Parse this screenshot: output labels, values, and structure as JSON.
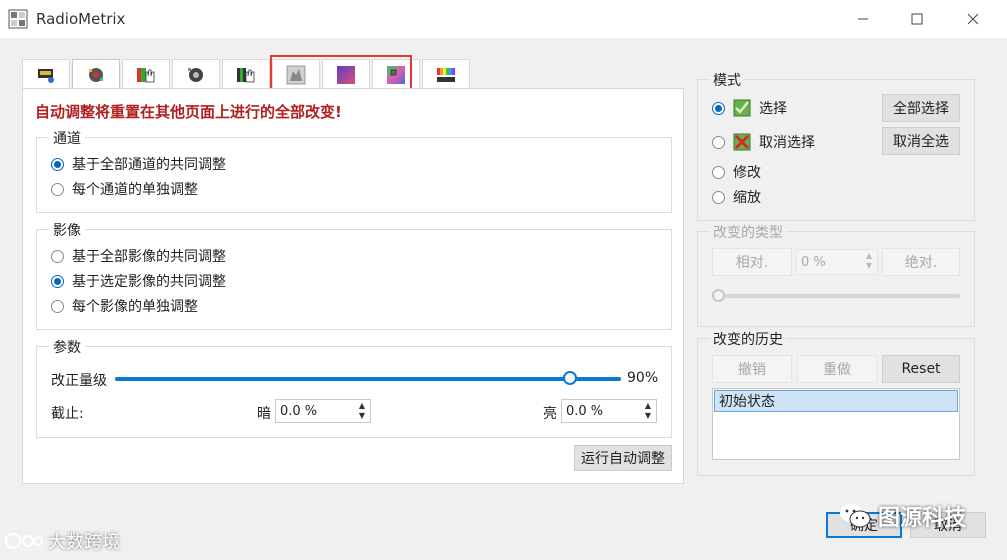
{
  "window": {
    "title": "RadioMetrix",
    "controls": [
      "minimize-icon",
      "maximize-icon",
      "close-icon"
    ]
  },
  "tabs": [
    {
      "icon": "display-settings-icon"
    },
    {
      "icon": "auto-adjust-icon",
      "active": true
    },
    {
      "icon": "hand-color-icon"
    },
    {
      "icon": "gear-gray-icon"
    },
    {
      "icon": "hand-gradient-icon"
    },
    {
      "icon": "grayscale-image-icon"
    },
    {
      "icon": "gradient-image-icon"
    },
    {
      "icon": "color-square-icon"
    },
    {
      "icon": "color-bars-icon"
    }
  ],
  "main": {
    "warning": "自动调整将重置在其他页面上进行的全部改变!",
    "channel_group": {
      "title": "通道",
      "options": [
        {
          "label": "基于全部通道的共同调整",
          "checked": true
        },
        {
          "label": "每个通道的单独调整",
          "checked": false
        }
      ]
    },
    "image_group": {
      "title": "影像",
      "options": [
        {
          "label": "基于全部影像的共同调整",
          "checked": false
        },
        {
          "label": "基于选定影像的共同调整",
          "checked": true
        },
        {
          "label": "每个影像的单独调整",
          "checked": false
        }
      ]
    },
    "params_group": {
      "title": "参数",
      "correction_label": "改正量级",
      "correction_value": "90%",
      "correction_fraction": 0.9,
      "cutoff_label": "截止:",
      "dark_label": "暗",
      "dark_value": "0.0 %",
      "bright_label": "亮",
      "bright_value": "0.0 %"
    },
    "run_button": "运行自动调整"
  },
  "mode": {
    "title": "模式",
    "options": [
      {
        "label": "选择",
        "checked": true,
        "icon": "check-select-icon"
      },
      {
        "label": "取消选择",
        "checked": false,
        "icon": "cross-deselect-icon"
      },
      {
        "label": "修改",
        "checked": false
      },
      {
        "label": "缩放",
        "checked": false
      }
    ],
    "select_all": "全部选择",
    "deselect_all": "取消全选"
  },
  "change_type": {
    "title": "改变的类型",
    "relative": "相对.",
    "value": "0 %",
    "absolute": "绝对."
  },
  "history": {
    "title": "改变的历史",
    "undo": "撤销",
    "redo": "重做",
    "reset": "Reset",
    "items": [
      "初始状态"
    ]
  },
  "footer": {
    "ok": "确定",
    "cancel": "取消"
  },
  "watermarks": {
    "left": "大数跨境",
    "right": "图源科技"
  }
}
